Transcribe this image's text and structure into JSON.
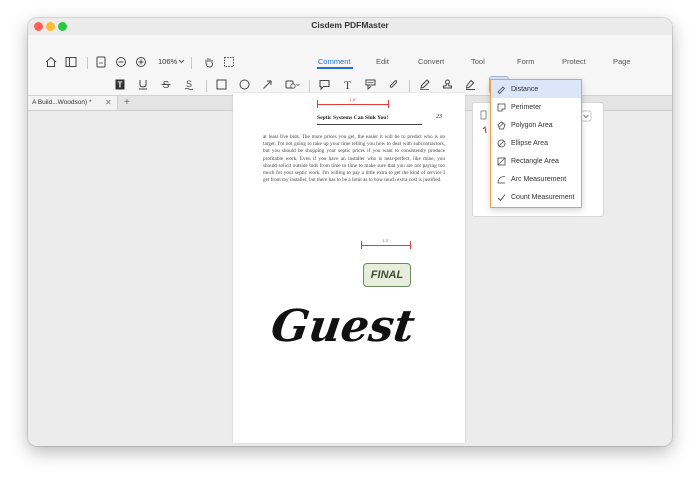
{
  "window": {
    "title": "Cisdem PDFMaster"
  },
  "toolbar": {
    "zoom": "106%",
    "tabs": [
      {
        "label": "Comment",
        "active": true
      },
      {
        "label": "Edit"
      },
      {
        "label": "Convert"
      },
      {
        "label": "Tool"
      },
      {
        "label": "Form"
      },
      {
        "label": "Protect"
      },
      {
        "label": "Page"
      }
    ]
  },
  "document_tab": {
    "label": "A Build...Woodson) *"
  },
  "page": {
    "running_head": "Septic Systems Can Sink You!",
    "page_number": "23",
    "body": "at least five bids. The more prices you get, the easier it will be to predict who is on target. I'm not going to take up your time telling you how to deal with subcontractors, but you should be shopping your septic prices if you want to consistently produce profitable work. Even if you have an installer who is near-perfect, like mine, you should solicit outside bids from time to time to make sure that you are not paying too much for your septic work. I'm willing to pay a little extra to get the kind of service I get from my installer, but there has to be a limit as to how much extra cost is justified.",
    "measure_top": "1.8\"",
    "measure_mid": "1.2\"",
    "stamp": "FINAL",
    "signature": "Guest"
  },
  "measure_menu": {
    "items": [
      {
        "label": "Distance",
        "icon": "ruler-icon",
        "selected": true
      },
      {
        "label": "Perimeter",
        "icon": "perimeter-icon"
      },
      {
        "label": "Polygon Area",
        "icon": "polygon-area-icon"
      },
      {
        "label": "Ellipse Area",
        "icon": "ellipse-area-icon"
      },
      {
        "label": "Rectangle Area",
        "icon": "rectangle-area-icon"
      },
      {
        "label": "Arc Measurement",
        "icon": "arc-icon"
      },
      {
        "label": "Count Measurement",
        "icon": "check-icon"
      }
    ]
  },
  "colors": {
    "accent": "#1f6fd6",
    "menu_border": "#f0a043",
    "measure_red": "#e23b3b"
  }
}
